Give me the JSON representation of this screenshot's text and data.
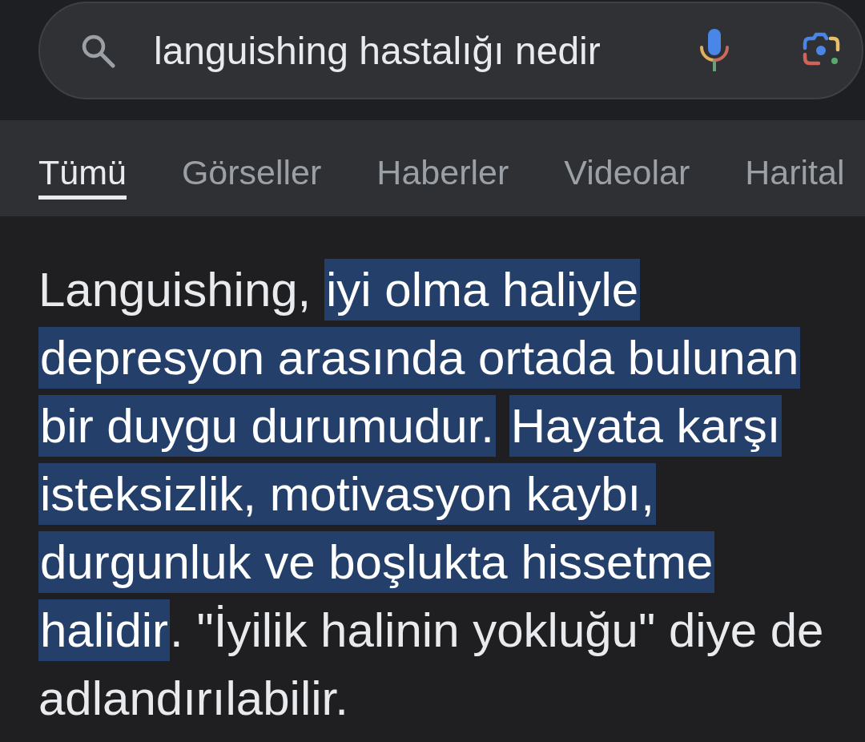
{
  "search": {
    "query": "languishing hastalığı nedir"
  },
  "tabs": [
    {
      "label": "Tümü",
      "selected": true
    },
    {
      "label": "Görseller",
      "selected": false
    },
    {
      "label": "Haberler",
      "selected": false
    },
    {
      "label": "Videolar",
      "selected": false
    },
    {
      "label": "Harital",
      "selected": false
    }
  ],
  "answer": {
    "segments": [
      {
        "text": "Languishing,",
        "highlighted": false
      },
      {
        "text": "iyi olma haliyle depresyon arasında ortada bulunan bir duygu durumudur.",
        "highlighted": true,
        "space_before": true
      },
      {
        "text": "Hayata karşı isteksizlik, motivasyon kaybı, durgunluk ve boşlukta hissetme halidir",
        "highlighted": true,
        "space_before": true
      },
      {
        "text": ". \"İyilik halinin yokluğu\" diye de adlandırılabilir.",
        "highlighted": false,
        "space_before": false
      }
    ]
  }
}
